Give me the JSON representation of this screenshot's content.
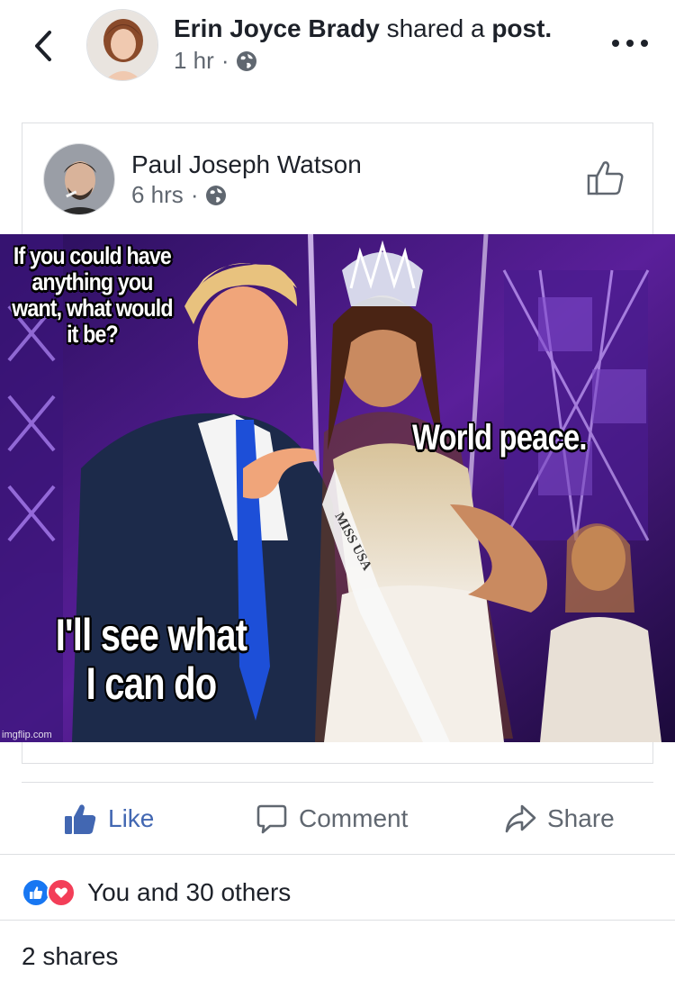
{
  "header": {
    "sharer_name": "Erin Joyce Brady",
    "shared_text": "shared a",
    "post_word": "post.",
    "time": "1 hr",
    "separator": "·",
    "privacy_icon": "globe-icon",
    "back_icon": "chevron-left-icon",
    "more_icon": "more-dots-icon"
  },
  "shared_post": {
    "author_name": "Paul Joseph Watson",
    "time": "6 hrs",
    "separator": "·",
    "privacy_icon": "globe-icon",
    "like_icon": "thumbs-up-outline-icon",
    "meme": {
      "question": "If you could have anything you want, what would it be?",
      "answer": "World peace.",
      "reply_line1": "I'll see what",
      "reply_line2": "I can do",
      "watermark": "imgflip.com",
      "sash_text": "MISS USA"
    }
  },
  "actions": {
    "like_label": "Like",
    "comment_label": "Comment",
    "share_label": "Share",
    "accent_color": "#4267b2",
    "muted_color": "#606770"
  },
  "reactions": {
    "summary": "You and 30 others",
    "like_color": "#1877f2",
    "love_color": "#f33e58"
  },
  "shares": {
    "text": "2 shares"
  }
}
